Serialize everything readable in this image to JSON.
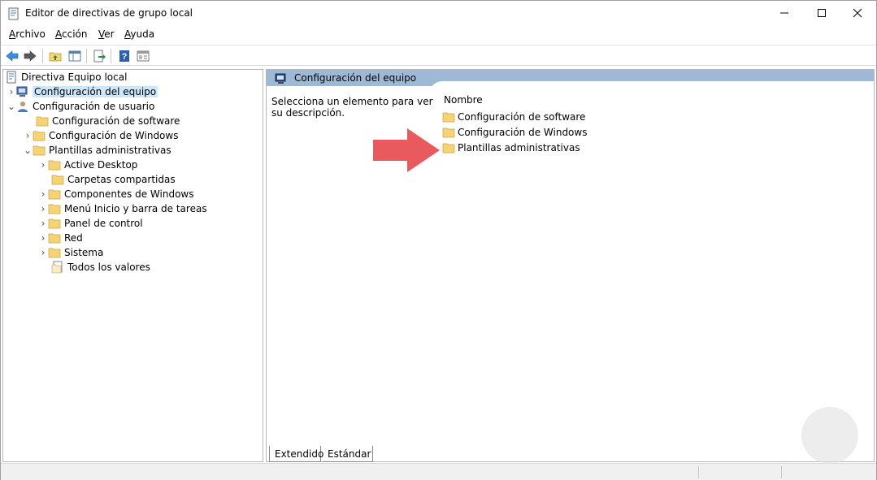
{
  "window": {
    "title": "Editor de directivas de grupo local"
  },
  "menu": {
    "items": [
      {
        "underline": "A",
        "rest": "rchivo"
      },
      {
        "underline": "A",
        "rest": "cción"
      },
      {
        "underline": "V",
        "rest": "er"
      },
      {
        "underline": "A",
        "rest": "yuda"
      }
    ]
  },
  "tree": {
    "root": "Directiva Equipo local",
    "computer_config": "Configuración del equipo",
    "user_config": "Configuración de usuario",
    "software_config": "Configuración de software",
    "windows_config": "Configuración de Windows",
    "admin_templates": "Plantillas administrativas",
    "children": [
      "Active Desktop",
      "Carpetas compartidas",
      "Componentes de Windows",
      "Menú Inicio y barra de tareas",
      "Panel de control",
      "Red",
      "Sistema",
      "Todos los valores"
    ]
  },
  "right_pane": {
    "header": "Configuración del equipo",
    "description": "Selecciona un elemento para ver su descripción.",
    "column_header": "Nombre",
    "items": [
      "Configuración de software",
      "Configuración de Windows",
      "Plantillas administrativas"
    ]
  },
  "tabs": {
    "extended": "Extendido",
    "standard": "Estándar"
  },
  "colors": {
    "header_bg": "#9db9d5",
    "selection": "#cce8ff",
    "arrow": "#e85a5e",
    "folder": "#f5d376"
  },
  "icons": {
    "back": "back-arrow-icon",
    "forward": "forward-arrow-icon",
    "folder": "folder-icon",
    "computer": "computer-icon",
    "user": "user-icon",
    "policy": "policy-document-icon"
  }
}
